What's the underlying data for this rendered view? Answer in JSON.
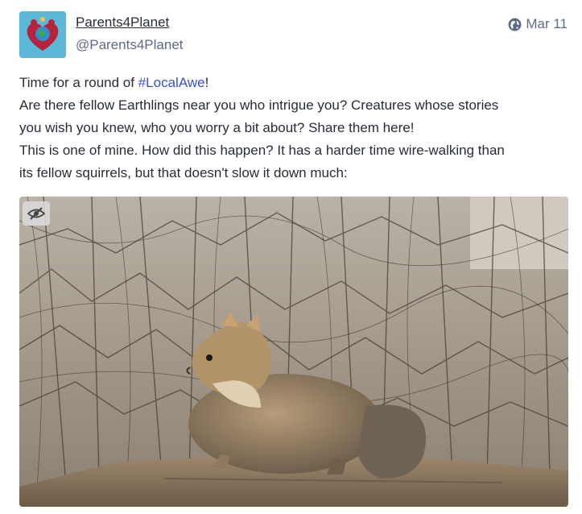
{
  "status": {
    "display_name": "Parents4Planet",
    "account": "@Parents4Planet",
    "timestamp": "Mar 11",
    "visibility_icon": "globe-icon",
    "content": {
      "line1_prefix": "Time for a round of ",
      "hashtag": "#LocalAwe",
      "line1_suffix": "!",
      "line2": "Are there fellow Earthlings near you who intrigue you? Creatures whose stories",
      "line3": "you wish you knew, who you worry a bit about? Share them here!",
      "line4": "This is one of mine. How did this happen? It has a harder time wire-walking than",
      "line5": "its fellow squirrels, but that doesn't slow it down much:"
    },
    "media": {
      "toggle_icon": "eye-slash-icon"
    }
  },
  "colors": {
    "text": "#282c37",
    "secondary": "#606984",
    "hashtag": "#3a4fd8",
    "avatar_bg": "#5bb8d6"
  }
}
